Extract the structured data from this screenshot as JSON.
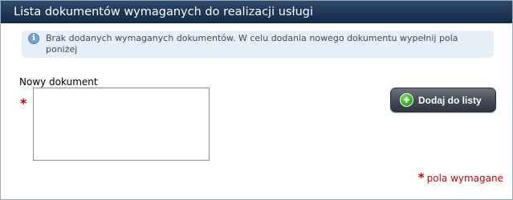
{
  "panel": {
    "title": "Lista dokumentów wymaganych do realizacji usługi"
  },
  "info": {
    "icon": "info-icon",
    "icon_glyph": "i",
    "message": "Brak dodanych wymaganych dokumentów. W celu dodania nowego dokumentu wypełnij pola poniżej"
  },
  "form": {
    "field_label": "Nowy dokument",
    "required_marker": "*",
    "textarea_value": ""
  },
  "actions": {
    "add_icon": "plus-circle-icon",
    "add_glyph": "+",
    "add_label": "Dodaj do listy"
  },
  "footer": {
    "required_marker": "*",
    "required_note": "pola wymagane"
  },
  "colors": {
    "header_bg": "#1f3656",
    "info_bg": "#e6eef8",
    "required": "#cc0000",
    "button_bg": "#454d57",
    "button_icon": "#3ea72a"
  }
}
